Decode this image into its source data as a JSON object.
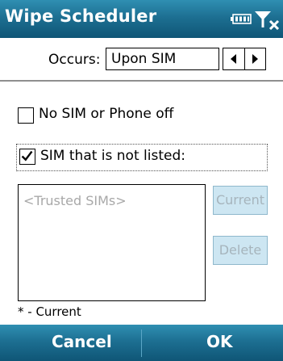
{
  "window": {
    "title": "Wipe Scheduler"
  },
  "status_icons": [
    "battery-icon",
    "signal-off-icon"
  ],
  "occurs": {
    "label": "Occurs:",
    "value": "Upon SIM"
  },
  "options": {
    "no_sim": {
      "label": "No SIM or Phone off",
      "checked": false
    },
    "unlisted_sim": {
      "label": "SIM that is not listed:",
      "checked": true
    }
  },
  "trusted_list": {
    "placeholder": "<Trusted SIMs>",
    "items": []
  },
  "buttons": {
    "current": "Current",
    "delete": "Delete"
  },
  "footnote": "* - Current",
  "softkeys": {
    "left": "Cancel",
    "right": "OK"
  },
  "colors": {
    "titlebar": "#1d6f92",
    "disabled_button": "#cde6f2"
  }
}
